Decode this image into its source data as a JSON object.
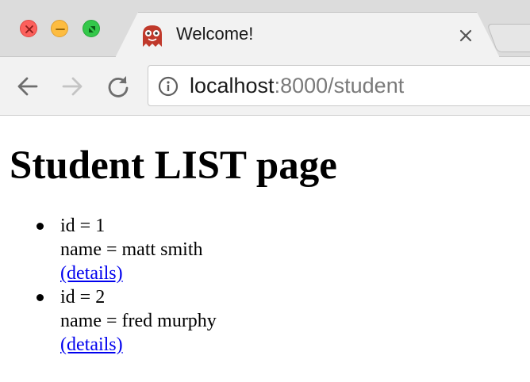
{
  "browser": {
    "tab": {
      "title": "Welcome!",
      "favicon": "ghost-icon"
    },
    "address_bar": {
      "host": "localhost",
      "rest": ":8000/student"
    }
  },
  "page": {
    "heading": "Student LIST page",
    "students": [
      {
        "id_text": "id = 1",
        "name_text": "name = matt smith",
        "link_label": "(details)"
      },
      {
        "id_text": "id = 2",
        "name_text": "name = fred murphy",
        "link_label": "(details)"
      }
    ]
  },
  "colors": {
    "link": "#0000ee",
    "close_light": "#fc605c",
    "minimize_light": "#fdbc40",
    "maximize_light": "#34c84a",
    "favicon": "#c0392b"
  }
}
